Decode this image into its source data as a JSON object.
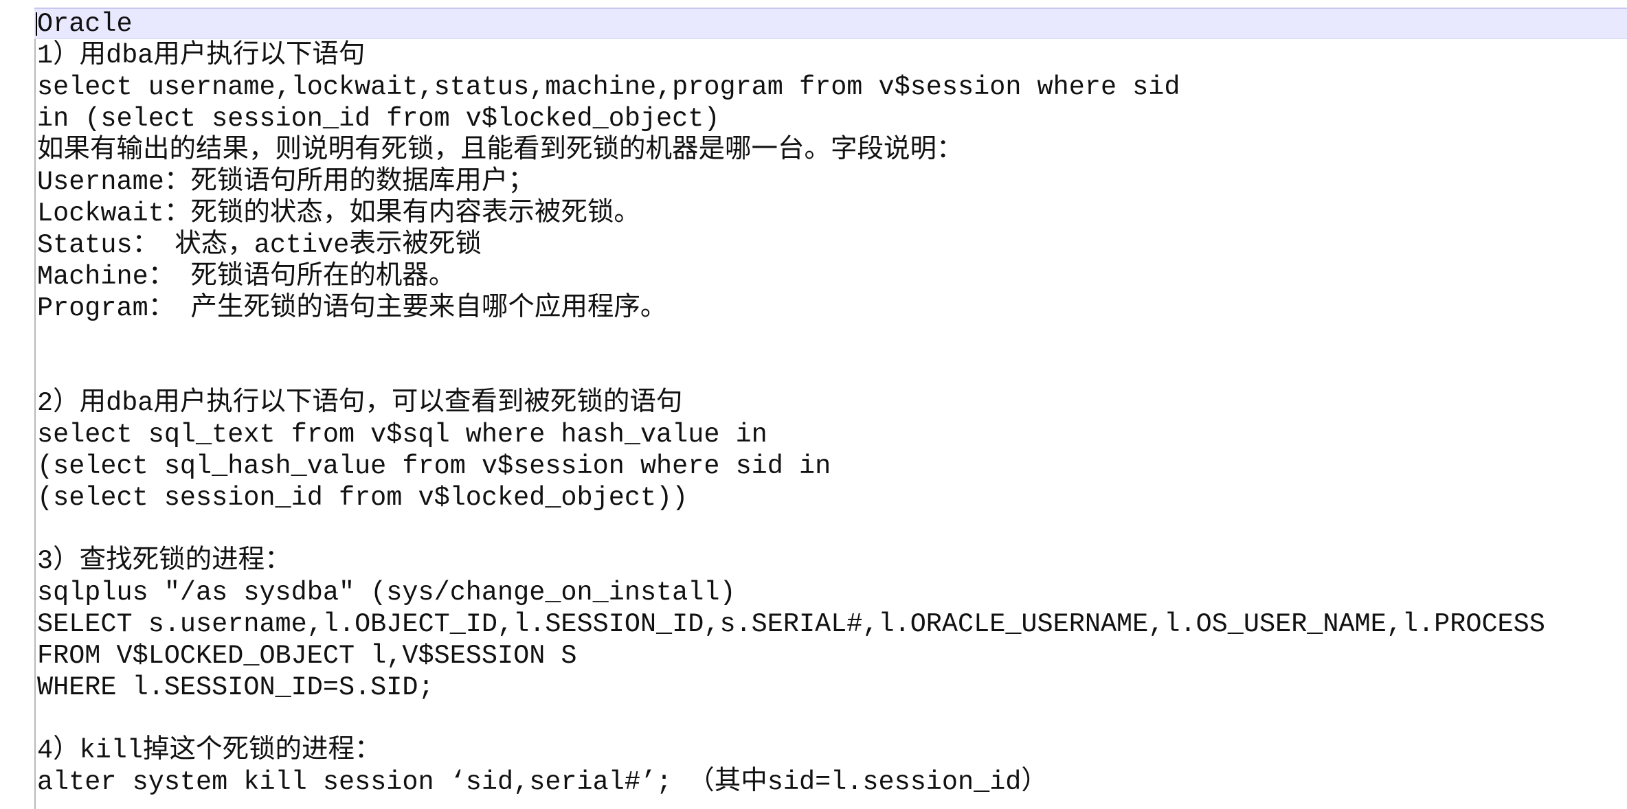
{
  "document": {
    "lines": [
      "Oracle",
      "1）用dba用户执行以下语句",
      "select username,lockwait,status,machine,program from v$session where sid",
      "in (select session_id from v$locked_object)",
      "如果有输出的结果，则说明有死锁，且能看到死锁的机器是哪一台。字段说明：",
      "Username：死锁语句所用的数据库用户；",
      "Lockwait：死锁的状态，如果有内容表示被死锁。",
      "Status： 状态，active表示被死锁",
      "Machine： 死锁语句所在的机器。",
      "Program： 产生死锁的语句主要来自哪个应用程序。",
      "",
      "",
      "2）用dba用户执行以下语句，可以查看到被死锁的语句",
      "select sql_text from v$sql where hash_value in",
      "(select sql_hash_value from v$session where sid in",
      "(select session_id from v$locked_object))",
      "",
      "3）查找死锁的进程：",
      "sqlplus \"/as sysdba\" (sys/change_on_install)",
      "SELECT s.username,l.OBJECT_ID,l.SESSION_ID,s.SERIAL#,l.ORACLE_USERNAME,l.OS_USER_NAME,l.PROCESS",
      "FROM V$LOCKED_OBJECT l,V$SESSION S",
      "WHERE l.SESSION_ID=S.SID;",
      "",
      "4）kill掉这个死锁的进程：",
      "alter system kill session ‘sid,serial#’; （其中sid=l.session_id）"
    ]
  },
  "colors": {
    "background": "#ffffff",
    "current_line_highlight": "#e8e8ff",
    "text": "#111111",
    "margin_line": "#b9b9b9"
  }
}
